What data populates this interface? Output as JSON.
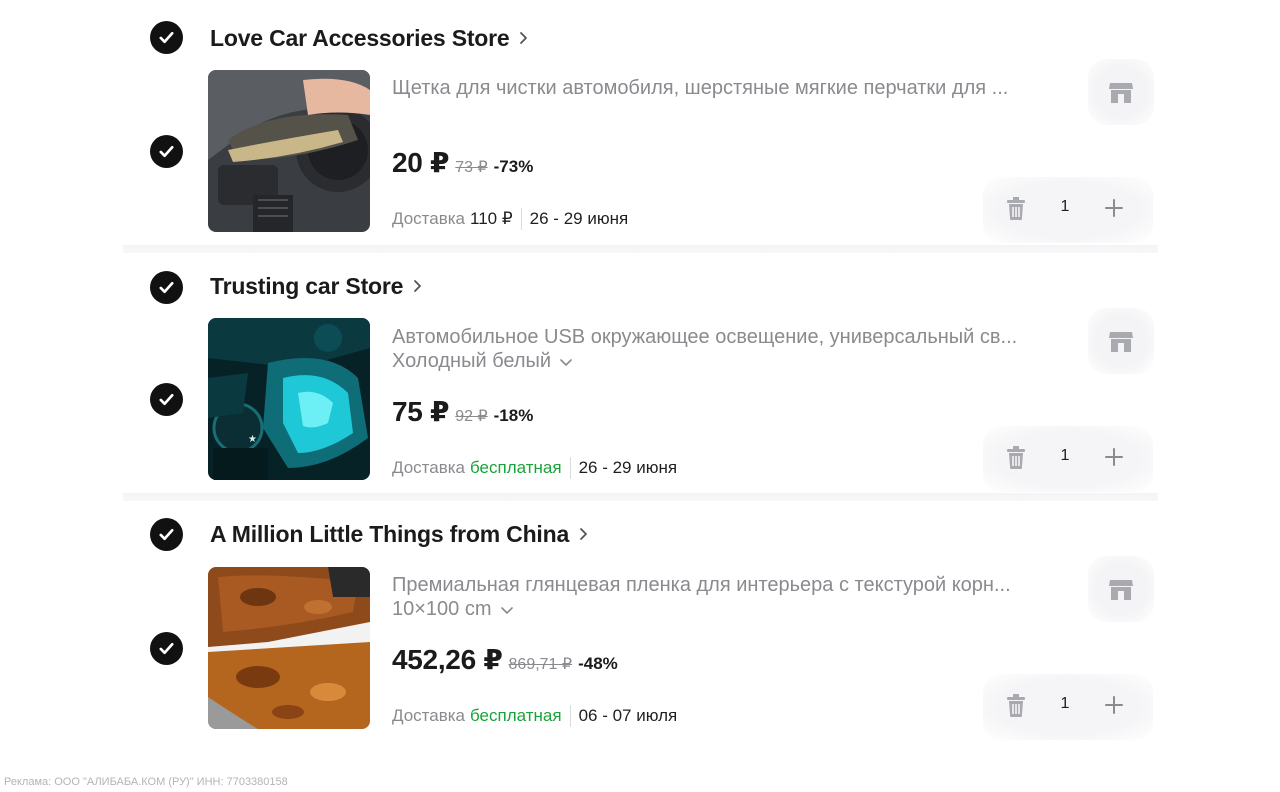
{
  "stores": [
    {
      "name": "Love Car Accessories Store",
      "item": {
        "title": "Щетка для чистки автомобиля, шерстяные мягкие перчатки для ...",
        "variant": "",
        "price": "20 ₽",
        "old_price": "73 ₽",
        "discount": "-73%",
        "delivery_label": "Доставка",
        "delivery_cost": "110 ₽",
        "delivery_dates": "26 - 29 июня",
        "quantity": "1"
      }
    },
    {
      "name": "Trusting car Store",
      "item": {
        "title": "Автомобильное USB окружающее освещение, универсальный св...",
        "variant": "Холодный белый",
        "price": "75 ₽",
        "old_price": "92 ₽",
        "discount": "-18%",
        "delivery_label": "Доставка",
        "delivery_cost": "бесплатная",
        "delivery_dates": "26 - 29 июня",
        "quantity": "1"
      }
    },
    {
      "name": "A Million Little Things from China",
      "item": {
        "title": "Премиальная глянцевая пленка для интерьера с текстурой корн...",
        "variant": "10×100 cm",
        "price": "452,26 ₽",
        "old_price": "869,71 ₽",
        "discount": "-48%",
        "delivery_label": "Доставка",
        "delivery_cost": "бесплатная",
        "delivery_dates": "06 - 07 июля",
        "quantity": "1"
      }
    }
  ],
  "footer_ad": "Реклама: ООО \"АЛИБАБА.КОМ (РУ)\" ИНН: 7703380158",
  "colors": {
    "check_bg": "#111111",
    "free_delivery": "#1aa33a",
    "muted_text": "#8a8a8f",
    "icon_gray": "#a9aab0"
  },
  "icons": [
    "checkmark-icon",
    "chevron-right-icon",
    "chevron-down-icon",
    "store-icon",
    "trash-icon",
    "plus-icon"
  ]
}
